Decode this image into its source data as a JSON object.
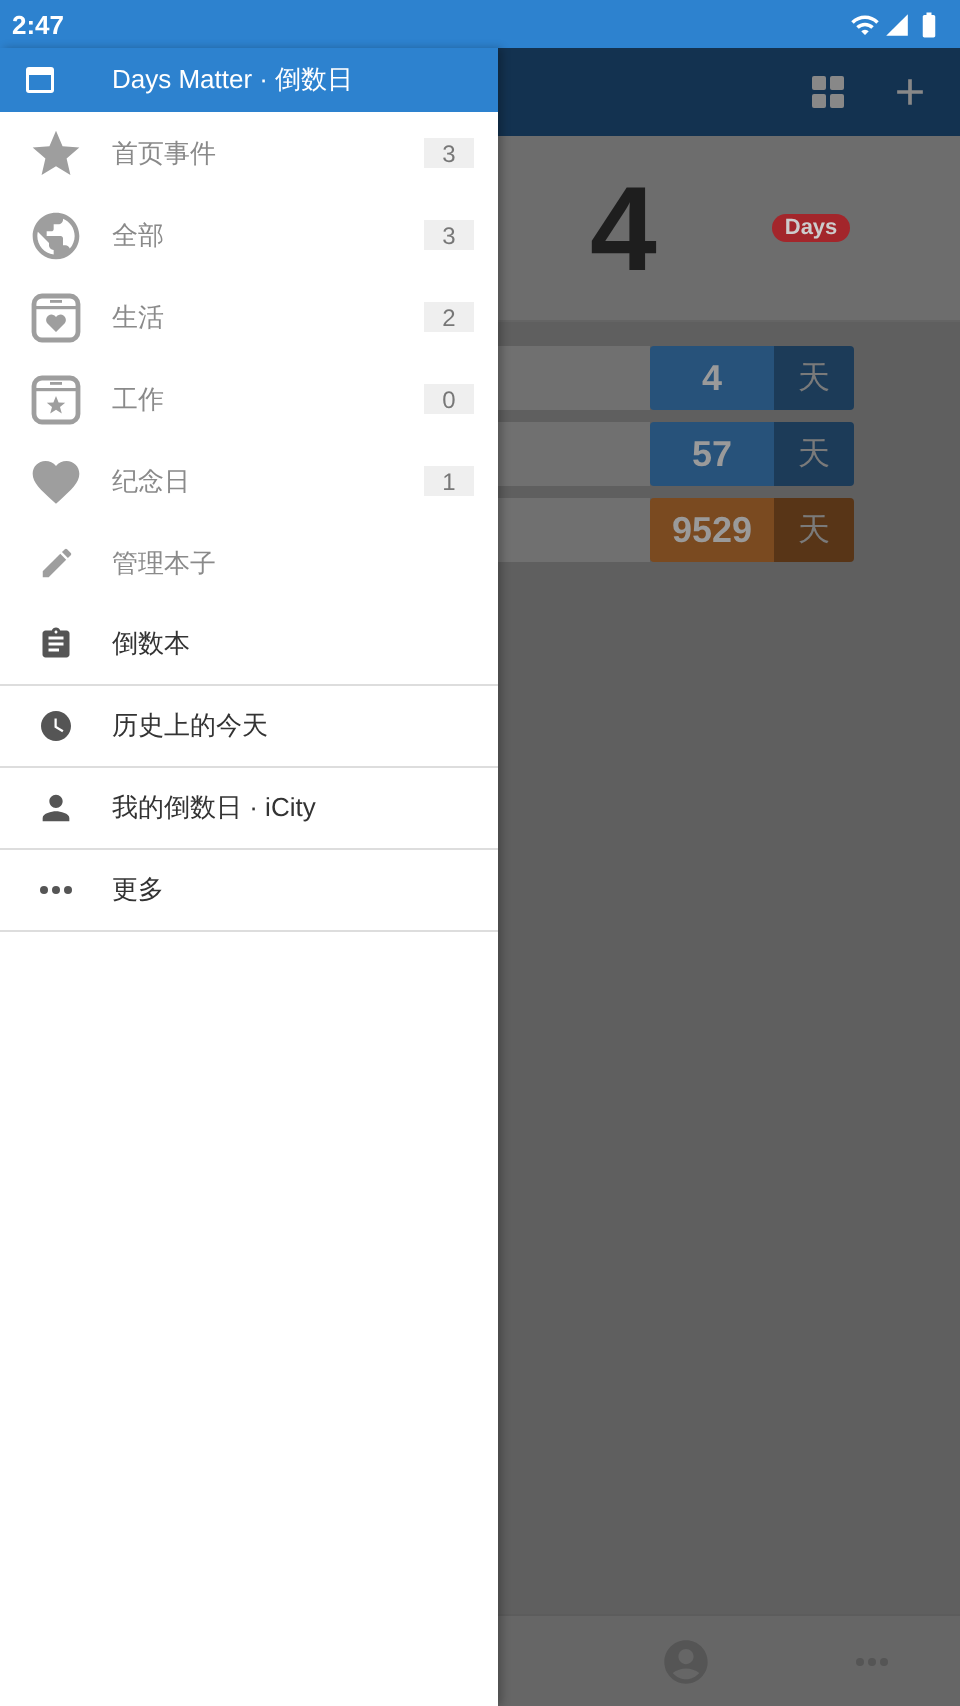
{
  "status_bar": {
    "time": "2:47"
  },
  "drawer": {
    "title": "Days Matter · 倒数日",
    "categories": [
      {
        "label": "首页事件",
        "count": "3"
      },
      {
        "label": "全部",
        "count": "3"
      },
      {
        "label": "生活",
        "count": "2"
      },
      {
        "label": "工作",
        "count": "0"
      },
      {
        "label": "纪念日",
        "count": "1"
      }
    ],
    "manage": {
      "label": "管理本子"
    },
    "menu": [
      {
        "label": "倒数本"
      },
      {
        "label": "历史上的今天"
      },
      {
        "label": "我的倒数日 · iCity"
      },
      {
        "label": "更多"
      }
    ]
  },
  "main": {
    "hero": {
      "number": "4",
      "unit": "Days"
    },
    "events": [
      {
        "number": "4",
        "unit": "天",
        "color": "#27527a"
      },
      {
        "number": "57",
        "unit": "天",
        "color": "#27527a"
      },
      {
        "number": "9529",
        "unit": "天",
        "color": "#7a4a20"
      }
    ]
  }
}
